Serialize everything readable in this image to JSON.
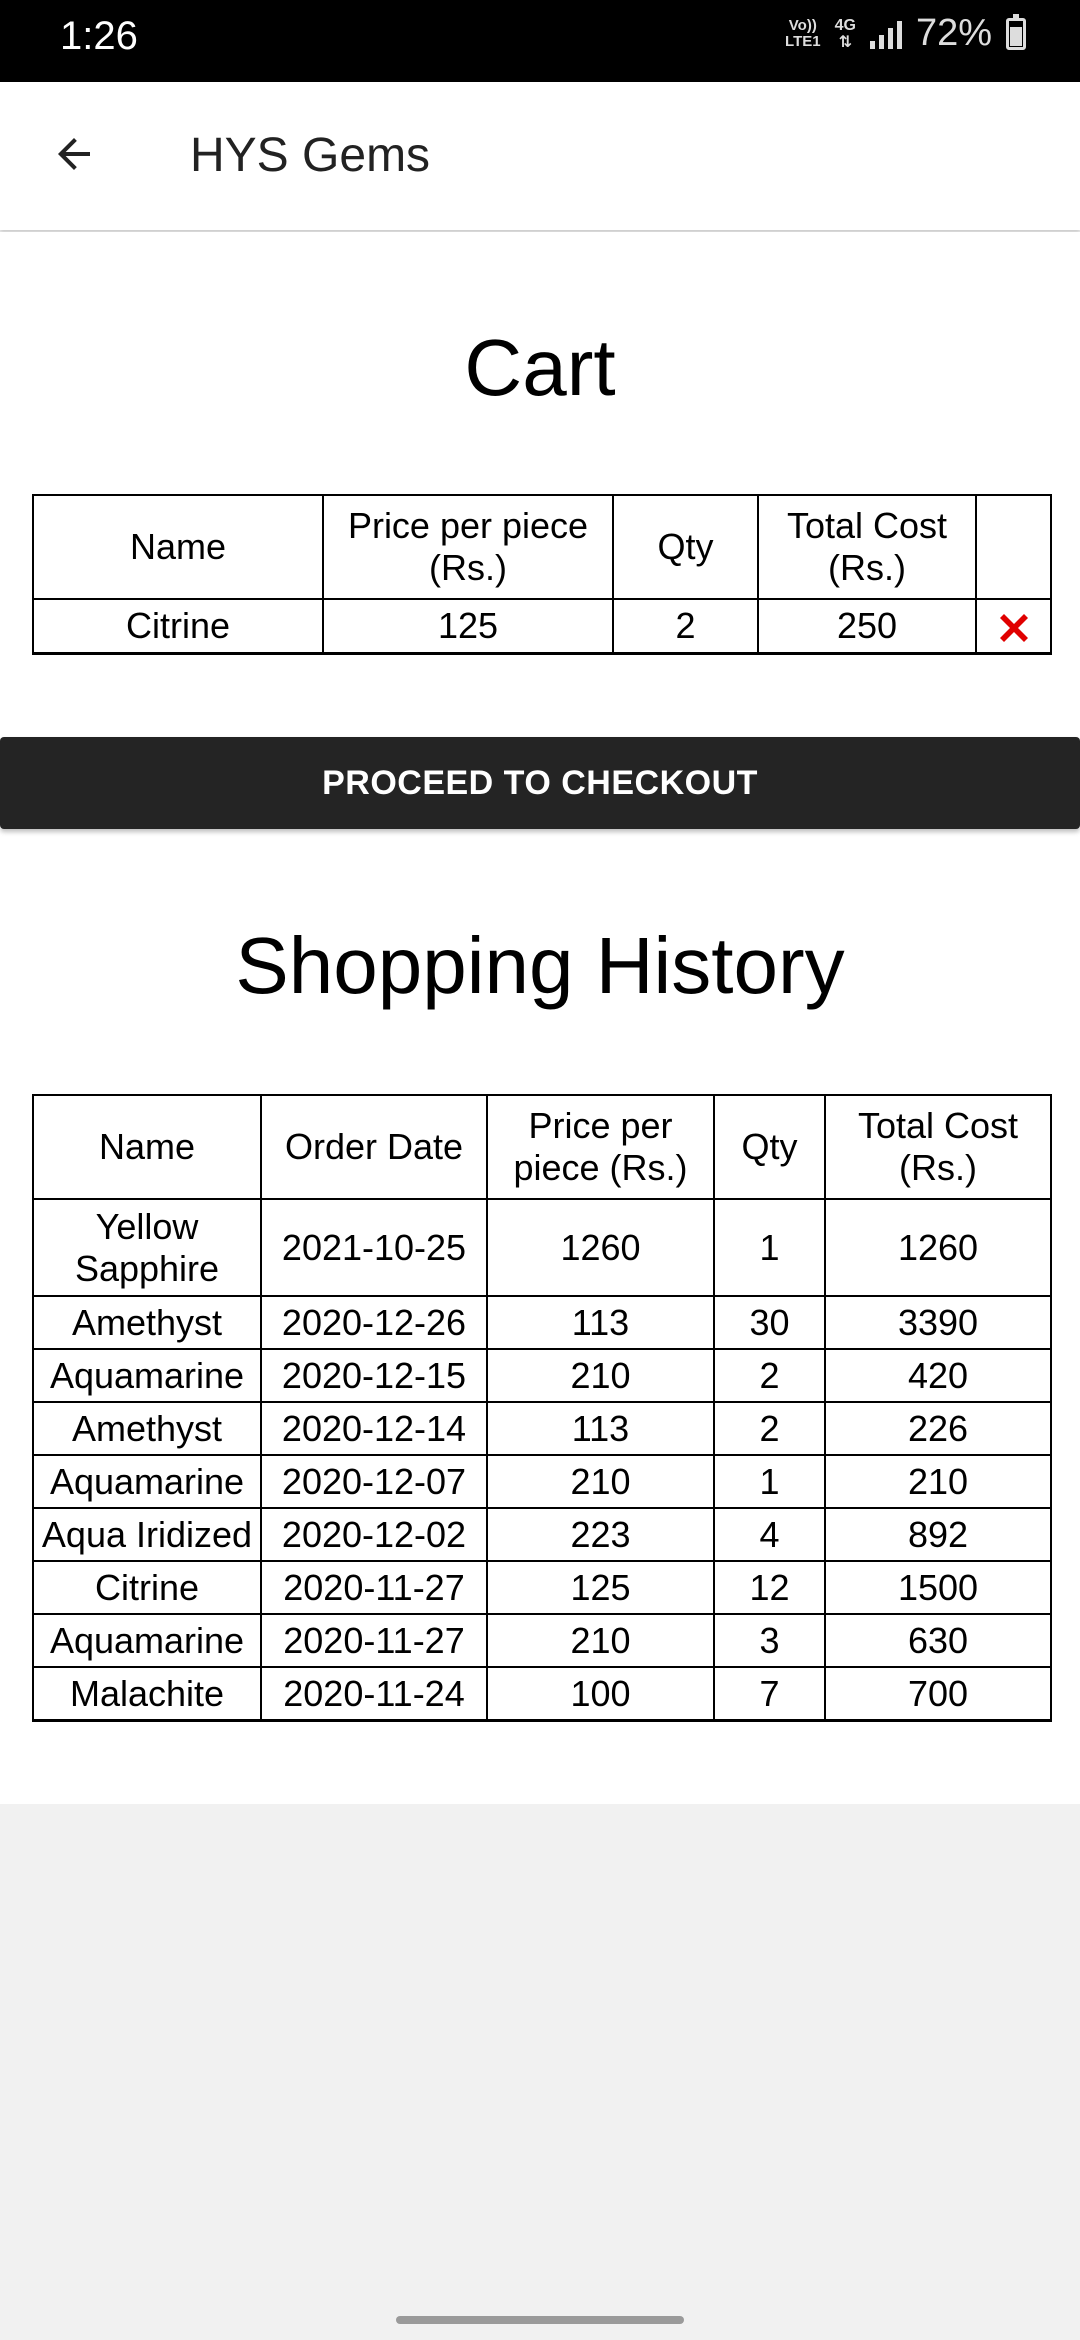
{
  "status_bar": {
    "time": "1:26",
    "network_top": "Vo))",
    "network_bottom": "LTE1",
    "network_type": "4G",
    "battery": "72%"
  },
  "app_bar": {
    "title": "HYS Gems",
    "back_icon": "arrow-back-icon"
  },
  "cart": {
    "title": "Cart",
    "headers": [
      "Name",
      "Price per piece (Rs.)",
      "Qty",
      "Total Cost (Rs.)",
      ""
    ],
    "rows": [
      {
        "name": "Citrine",
        "price": "125",
        "qty": "2",
        "total": "250",
        "delete_icon": "close-x-icon",
        "delete_color": "#e00000"
      }
    ]
  },
  "checkout": {
    "label": "PROCEED TO CHECKOUT"
  },
  "history": {
    "title": "Shopping History",
    "headers": [
      "Name",
      "Order Date",
      "Price per piece (Rs.)",
      "Qty",
      "Total Cost (Rs.)"
    ],
    "rows": [
      {
        "name": "Yellow Sapphire",
        "date": "2021-10-25",
        "price": "1260",
        "qty": "1",
        "total": "1260"
      },
      {
        "name": "Amethyst",
        "date": "2020-12-26",
        "price": "113",
        "qty": "30",
        "total": "3390"
      },
      {
        "name": "Aquamarine",
        "date": "2020-12-15",
        "price": "210",
        "qty": "2",
        "total": "420"
      },
      {
        "name": "Amethyst",
        "date": "2020-12-14",
        "price": "113",
        "qty": "2",
        "total": "226"
      },
      {
        "name": "Aquamarine",
        "date": "2020-12-07",
        "price": "210",
        "qty": "1",
        "total": "210"
      },
      {
        "name": "Aqua Iridized",
        "date": "2020-12-02",
        "price": "223",
        "qty": "4",
        "total": "892"
      },
      {
        "name": "Citrine",
        "date": "2020-11-27",
        "price": "125",
        "qty": "12",
        "total": "1500"
      },
      {
        "name": "Aquamarine",
        "date": "2020-11-27",
        "price": "210",
        "qty": "3",
        "total": "630"
      },
      {
        "name": "Malachite",
        "date": "2020-11-24",
        "price": "100",
        "qty": "7",
        "total": "700"
      }
    ]
  }
}
